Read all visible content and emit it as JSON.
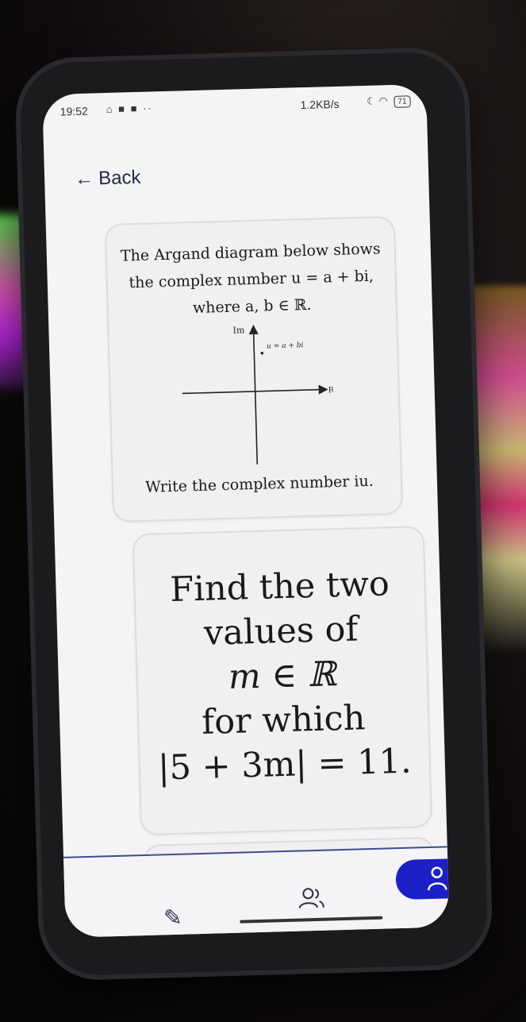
{
  "status_bar": {
    "time": "19:52",
    "icons": "⌂ ■ ■ ··",
    "speed": "1.2KB/s",
    "battery": "71"
  },
  "back_label": "Back",
  "card1": {
    "line1": "The Argand diagram below shows",
    "line2": "the complex number u = a + bi,",
    "line3": "where a, b ∈ ℝ.",
    "axis_im": "Im",
    "axis_re": "Re",
    "point_label": "u = a + bi",
    "question": "Write the complex number iu."
  },
  "card2": {
    "line1": "Find the two",
    "line2": "values of",
    "line3": "m ∈ ℝ",
    "line4": "for which",
    "line5": "|5 + 3m| = 11."
  },
  "nav": {
    "items": [
      "pencil-icon",
      "people-icon",
      "profile-icon"
    ],
    "active": "profile-icon",
    "accent": "#1d1fc8"
  }
}
